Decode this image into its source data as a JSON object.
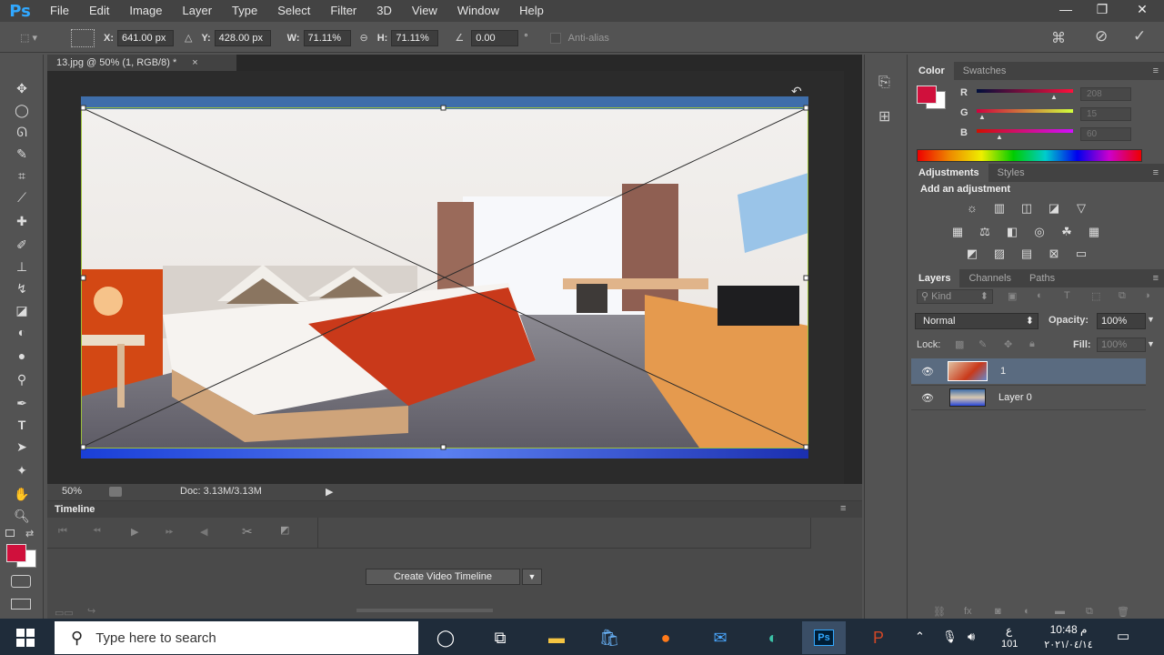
{
  "app": {
    "logo": "Ps"
  },
  "menu": [
    "File",
    "Edit",
    "Image",
    "Layer",
    "Type",
    "Select",
    "Filter",
    "3D",
    "View",
    "Window",
    "Help"
  ],
  "window_controls": {
    "minimize": "—",
    "restore": "❐",
    "close": "✕"
  },
  "options": {
    "x_label": "X:",
    "x_value": "641.00 px",
    "y_label": "Y:",
    "y_value": "428.00 px",
    "w_label": "W:",
    "w_value": "71.11%",
    "h_label": "H:",
    "h_value": "71.11%",
    "angle_value": "0.00",
    "angle_unit": "°",
    "antialias_label": "Anti-alias"
  },
  "document": {
    "tab_title": "13.jpg @ 50% (1, RGB/8) *",
    "close": "×",
    "zoom": "50%",
    "doc_info": "Doc: 3.13M/3.13M"
  },
  "timeline": {
    "title": "Timeline",
    "create_button": "Create Video Timeline"
  },
  "color_panel": {
    "tabs": [
      "Color",
      "Swatches"
    ],
    "r_label": "R",
    "r_value": "208",
    "g_label": "G",
    "g_value": "15",
    "b_label": "B",
    "b_value": "60",
    "foreground": "#d0103c",
    "background": "#ffffff"
  },
  "adjustments_panel": {
    "tabs": [
      "Adjustments",
      "Styles"
    ],
    "heading": "Add an adjustment"
  },
  "layers_panel": {
    "tabs": [
      "Layers",
      "Channels",
      "Paths"
    ],
    "filter": "Kind",
    "blend_mode": "Normal",
    "opacity_label": "Opacity:",
    "opacity_value": "100%",
    "lock_label": "Lock:",
    "fill_label": "Fill:",
    "fill_value": "100%",
    "layers": [
      {
        "name": "1",
        "selected": true
      },
      {
        "name": "Layer 0",
        "selected": false
      }
    ]
  },
  "taskbar": {
    "search_placeholder": "Type here to search",
    "time": "10:48 م",
    "date": "٢٠٢١/٠٤/١٤",
    "lang": "ع",
    "kb": "101"
  }
}
